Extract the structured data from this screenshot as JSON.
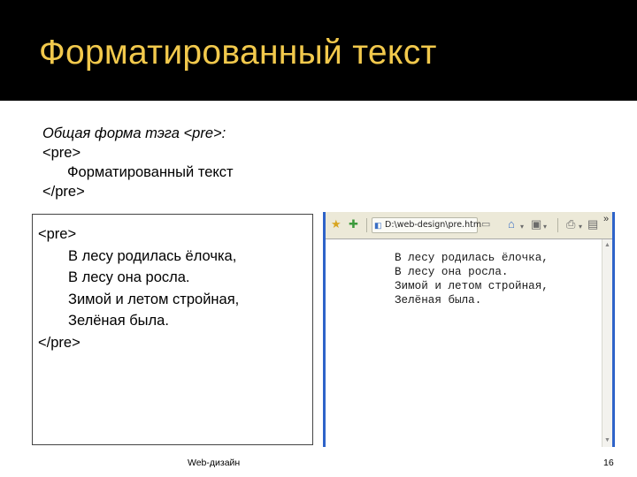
{
  "slide": {
    "title": "Форматированный текст"
  },
  "general_form": {
    "intro": "Общая форма тэга <pre>:",
    "open_tag": "<pre>",
    "content": "Форматированный текст",
    "close_tag": "</pre>"
  },
  "example_code": {
    "open_tag": "<pre>",
    "lines": [
      "В лесу родилась ёлочка,",
      "В лесу она росла.",
      "Зимой и летом стройная,",
      "Зелёная была."
    ],
    "close_tag": "</pre>"
  },
  "browser": {
    "tab_title": "D:\\web-design\\pre.htm",
    "rendered_text": "В лесу родилась ёлочка,\nВ лесу она росла.\nЗимой и летом стройная,\nЗелёная была.",
    "overflow": "»"
  },
  "footer": {
    "text": "Web-дизайн",
    "page_number": "16"
  },
  "colors": {
    "title_bar": "#000000",
    "title_text": "#f2c94c",
    "browser_border": "#2e63c9"
  }
}
